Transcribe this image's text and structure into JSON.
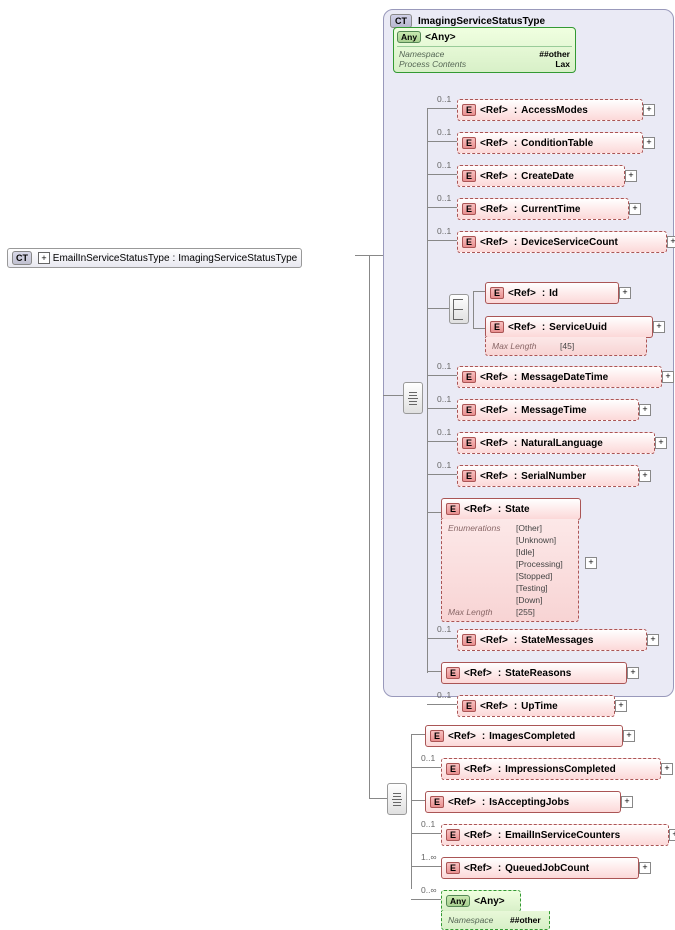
{
  "root": {
    "name": "EmailInServiceStatusType",
    "base": "ImagingServiceStatusType"
  },
  "labels": {
    "ref": "<Ref>",
    "maxLength": "Max Length",
    "enumerations": "Enumerations"
  },
  "occurs": {
    "opt": "0..1",
    "many1": "1..∞",
    "many0": "0..∞"
  },
  "anyAttr": {
    "label": "<Any>",
    "rows": [
      {
        "label": "Namespace",
        "value": "##other"
      },
      {
        "label": "Process Contents",
        "value": "Lax"
      }
    ]
  },
  "baseElements": [
    {
      "name": "AccessModes"
    },
    {
      "name": "ConditionTable"
    },
    {
      "name": "CreateDate"
    },
    {
      "name": "CurrentTime"
    },
    {
      "name": "DeviceServiceCount"
    },
    {
      "name": "MessageDateTime"
    },
    {
      "name": "MessageTime"
    },
    {
      "name": "NaturalLanguage"
    },
    {
      "name": "SerialNumber"
    },
    {
      "name": "StateMessages"
    },
    {
      "name": "StateReasons"
    },
    {
      "name": "UpTime"
    }
  ],
  "choiceElements": [
    {
      "name": "Id"
    },
    {
      "name": "ServiceUuid",
      "maxLength": "[45]"
    }
  ],
  "stateElement": {
    "name": "State",
    "enumerations": [
      "[Other]",
      "[Unknown]",
      "[Idle]",
      "[Processing]",
      "[Stopped]",
      "[Testing]",
      "[Down]"
    ],
    "maxLength": "[255]"
  },
  "extElements": [
    {
      "name": "ImagesCompleted"
    },
    {
      "name": "ImpressionsCompleted"
    },
    {
      "name": "IsAcceptingJobs"
    },
    {
      "name": "EmailInServiceCounters"
    },
    {
      "name": "QueuedJobCount"
    }
  ]
}
